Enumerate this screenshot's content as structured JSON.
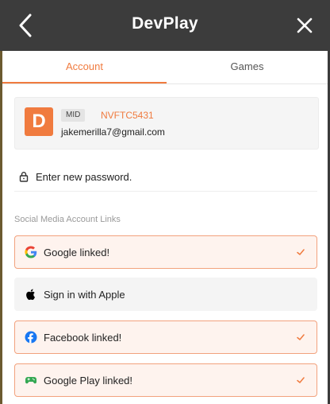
{
  "header": {
    "title": "DevPlay"
  },
  "tabs": [
    {
      "label": "Account",
      "active": true
    },
    {
      "label": "Games",
      "active": false
    }
  ],
  "account": {
    "avatar_letter": "D",
    "mid_label": "MID",
    "mid_value": "NVFTC5431",
    "email": "jakemerilla7@gmail.com"
  },
  "password": {
    "placeholder": "Enter new password."
  },
  "social": {
    "section_title": "Social Media Account Links",
    "links": [
      {
        "label": "Google linked!",
        "linked": true,
        "icon": "google-icon"
      },
      {
        "label": "Sign in with Apple",
        "linked": false,
        "icon": "apple-icon"
      },
      {
        "label": "Facebook linked!",
        "linked": true,
        "icon": "facebook-icon"
      },
      {
        "label": "Google Play linked!",
        "linked": true,
        "icon": "google-play-games-icon"
      }
    ]
  },
  "colors": {
    "accent": "#f07b3f",
    "header_bg": "#3c3c3c",
    "linked_bg": "#fef3ee",
    "linked_border": "#f2a27d"
  }
}
